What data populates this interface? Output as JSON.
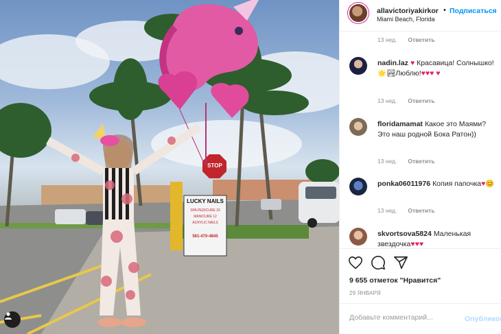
{
  "header": {
    "username": "allavictoriyakirkor",
    "dot": "•",
    "follow_label": "Подписаться",
    "location": "Miami Beach, Florida"
  },
  "first_meta": {
    "time": "13 нед.",
    "reply": "Ответить"
  },
  "comments": [
    {
      "username": "nadin.laz",
      "text": "♥ Красавица! Солнышко!🌟🏞Люблю!♥♥♥ ♥",
      "time": "13 нед.",
      "reply": "Ответить"
    },
    {
      "username": "floridamamat",
      "text": "Какое это Маями? Это наш родной Бока Ратон))",
      "time": "13 нед.",
      "reply": "Ответить"
    },
    {
      "username": "ponka06011976",
      "text": "Копия папочка♥😊",
      "time": "13 нед.",
      "reply": "Ответить"
    },
    {
      "username": "skvortsova5824",
      "text": "Маленькая звездочка♥♥♥",
      "time": "",
      "reply": ""
    }
  ],
  "actions": {
    "icons": [
      "heart-icon",
      "comment-icon",
      "share-icon"
    ],
    "likes": "9 655 отметок \"Нравится\"",
    "date": "29 ЯНВАРЯ"
  },
  "add_comment": {
    "placeholder": "Добавьте комментарий...",
    "post_label": "Опубликовать"
  },
  "photo": {
    "sign_title": "LUCKY NAILS",
    "sign_line1": "SPA PEDICURE 22",
    "sign_line2": "MANICURE 12",
    "sign_line3": "ACRYLIC NAILS",
    "sign_phone": "561-470-4845",
    "stop_label": "STOP"
  },
  "colors": {
    "accent": "#0095f6",
    "heart": "#e0245e",
    "muted": "#8e8e8e"
  }
}
